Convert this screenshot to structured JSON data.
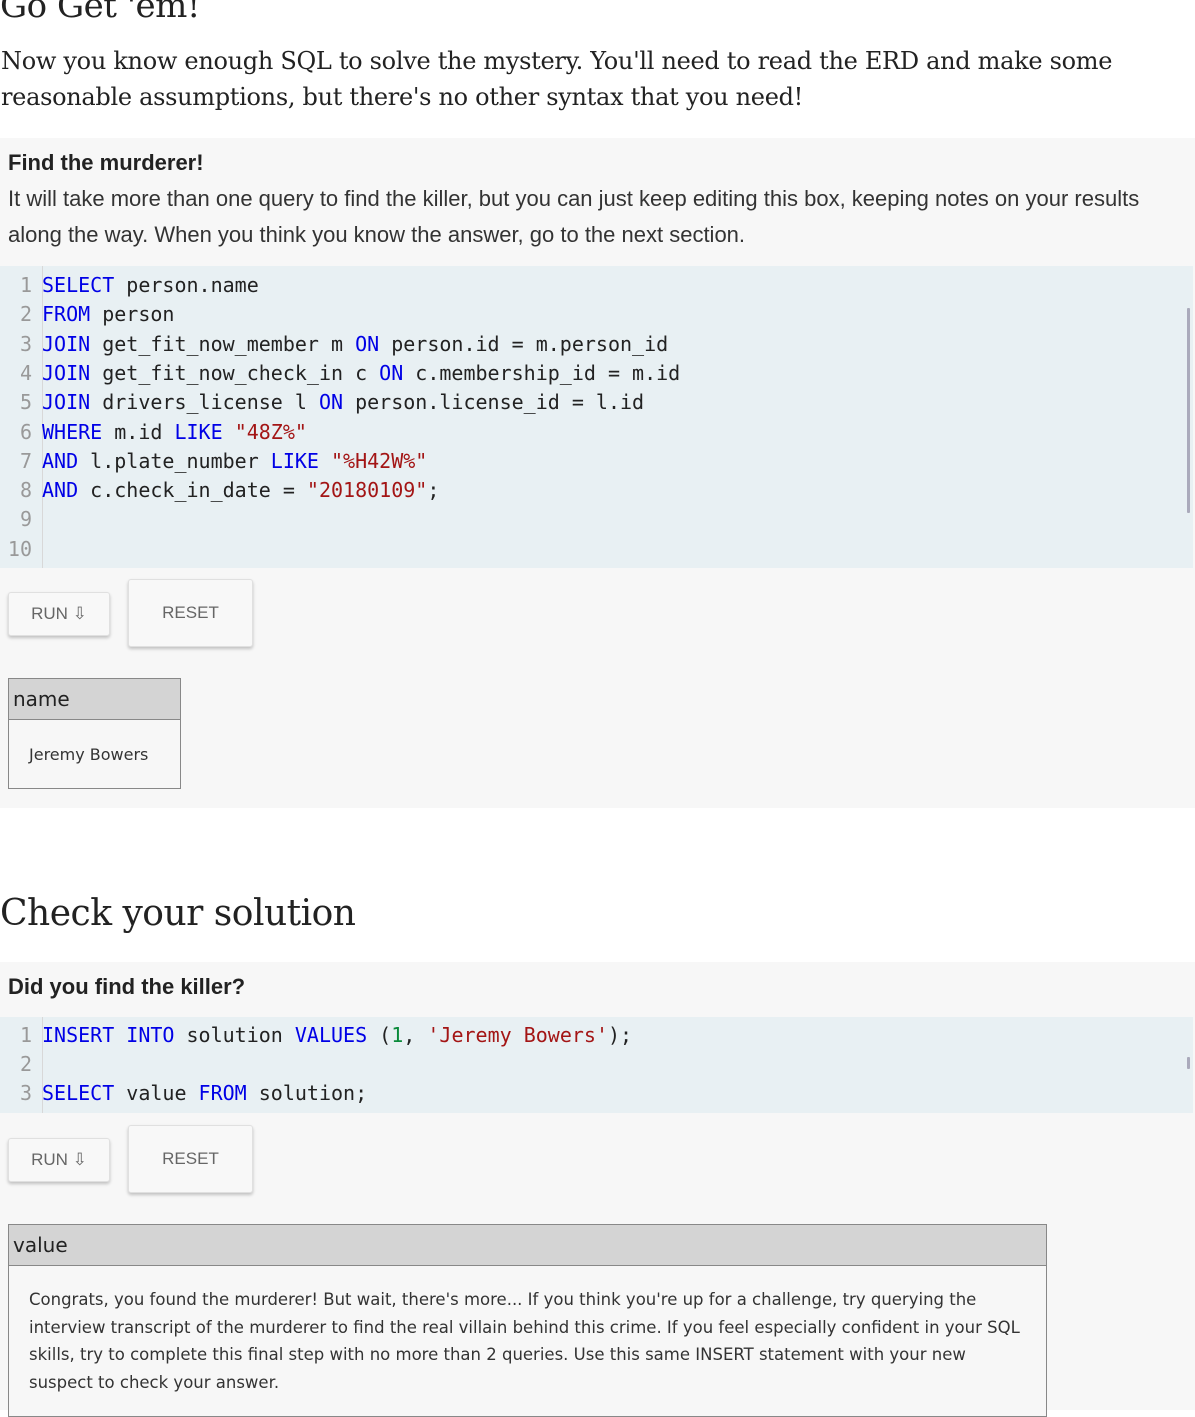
{
  "section1": {
    "heading": "Go Get 'em!",
    "intro": "Now you know enough SQL to solve the mystery. You'll need to read the ERD and make some reasonable assumptions, but there's no other syntax that you need!",
    "box_title": "Find the murderer!",
    "box_desc": "It will take more than one query to find the killer, but you can just keep editing this box, keeping notes on your results along the way. When you think you know the answer, go to the next section.",
    "code_lines": [
      {
        "n": "1",
        "tokens": [
          {
            "t": "SELECT",
            "c": "kw"
          },
          {
            "t": " person.name",
            "c": "txt"
          }
        ]
      },
      {
        "n": "2",
        "tokens": [
          {
            "t": "FROM",
            "c": "kw"
          },
          {
            "t": " person",
            "c": "txt"
          }
        ]
      },
      {
        "n": "3",
        "tokens": [
          {
            "t": "JOIN",
            "c": "kw"
          },
          {
            "t": " get_fit_now_member m ",
            "c": "txt"
          },
          {
            "t": "ON",
            "c": "kw"
          },
          {
            "t": " person.id = m.person_id",
            "c": "txt"
          }
        ]
      },
      {
        "n": "4",
        "tokens": [
          {
            "t": "JOIN",
            "c": "kw"
          },
          {
            "t": " get_fit_now_check_in c ",
            "c": "txt"
          },
          {
            "t": "ON",
            "c": "kw"
          },
          {
            "t": " c.membership_id = m.id",
            "c": "txt"
          }
        ]
      },
      {
        "n": "5",
        "tokens": [
          {
            "t": "JOIN",
            "c": "kw"
          },
          {
            "t": " drivers_license l ",
            "c": "txt"
          },
          {
            "t": "ON",
            "c": "kw"
          },
          {
            "t": " person.license_id = l.id",
            "c": "txt"
          }
        ]
      },
      {
        "n": "6",
        "tokens": [
          {
            "t": "WHERE",
            "c": "kw"
          },
          {
            "t": " m.id ",
            "c": "txt"
          },
          {
            "t": "LIKE",
            "c": "kw"
          },
          {
            "t": " ",
            "c": "txt"
          },
          {
            "t": "\"48Z%\"",
            "c": "str"
          }
        ]
      },
      {
        "n": "7",
        "tokens": [
          {
            "t": "AND",
            "c": "kw"
          },
          {
            "t": " l.plate_number ",
            "c": "txt"
          },
          {
            "t": "LIKE",
            "c": "kw"
          },
          {
            "t": " ",
            "c": "txt"
          },
          {
            "t": "\"%H42W%\"",
            "c": "str"
          }
        ]
      },
      {
        "n": "8",
        "tokens": [
          {
            "t": "AND",
            "c": "kw"
          },
          {
            "t": " c.check_in_date = ",
            "c": "txt"
          },
          {
            "t": "\"20180109\"",
            "c": "str"
          },
          {
            "t": ";",
            "c": "txt"
          }
        ]
      },
      {
        "n": "9",
        "tokens": []
      },
      {
        "n": "10",
        "tokens": []
      }
    ],
    "run_label": "RUN ⇩",
    "reset_label": "RESET",
    "result_header": "name",
    "result_value": "Jeremy Bowers"
  },
  "section2": {
    "heading": "Check your solution",
    "box_title": "Did you find the killer?",
    "code_lines": [
      {
        "n": "1",
        "tokens": [
          {
            "t": "INSERT",
            "c": "kw"
          },
          {
            "t": " ",
            "c": "txt"
          },
          {
            "t": "INTO",
            "c": "kw"
          },
          {
            "t": " solution ",
            "c": "txt"
          },
          {
            "t": "VALUES",
            "c": "kw"
          },
          {
            "t": " (",
            "c": "txt"
          },
          {
            "t": "1",
            "c": "num"
          },
          {
            "t": ", ",
            "c": "txt"
          },
          {
            "t": "'Jeremy Bowers'",
            "c": "str"
          },
          {
            "t": ");",
            "c": "txt"
          }
        ]
      },
      {
        "n": "2",
        "tokens": []
      },
      {
        "n": "3",
        "tokens": [
          {
            "t": "SELECT",
            "c": "kw"
          },
          {
            "t": " value ",
            "c": "txt"
          },
          {
            "t": "FROM",
            "c": "kw"
          },
          {
            "t": " solution;",
            "c": "txt"
          }
        ]
      }
    ],
    "run_label": "RUN ⇩",
    "reset_label": "RESET",
    "result_header": "value",
    "result_value": "Congrats, you found the murderer! But wait, there's more... If you think you're up for a challenge, try querying the interview transcript of the murderer to find the real villain behind this crime. If you feel especially confident in your SQL skills, try to complete this final step with no more than 2 queries. Use this same INSERT statement with your new suspect to check your answer."
  }
}
